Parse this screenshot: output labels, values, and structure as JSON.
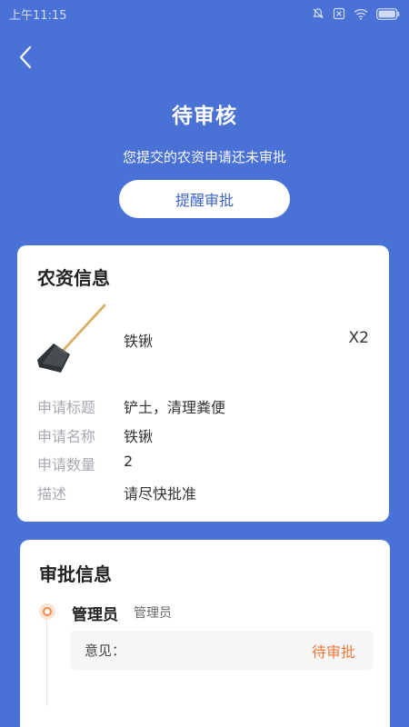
{
  "status_bar": {
    "time": "上午11:15"
  },
  "header": {
    "title": "待审核",
    "subtitle": "您提交的农资申请还未审批",
    "remind_button": "提醒审批"
  },
  "material_card": {
    "title": "农资信息",
    "item": {
      "name": "铁锹",
      "quantity": "X2",
      "image_icon": "shovel-image"
    },
    "rows": [
      {
        "label": "申请标题",
        "value": "铲土，清理粪便"
      },
      {
        "label": "申请名称",
        "value": "铁锹"
      },
      {
        "label": "申请数量",
        "value": "2"
      },
      {
        "label": "描述",
        "value": "请尽快批准"
      }
    ]
  },
  "approval_card": {
    "title": "审批信息",
    "approver": {
      "name": "管理员",
      "role": "管理员"
    },
    "opinion_label": "意见：",
    "opinion_status": "待审批"
  },
  "colors": {
    "header_bg": "#4a72d6",
    "button_text": "#3d64c8",
    "pending": "#f07a3c",
    "label_gray": "#a9a9b2"
  }
}
